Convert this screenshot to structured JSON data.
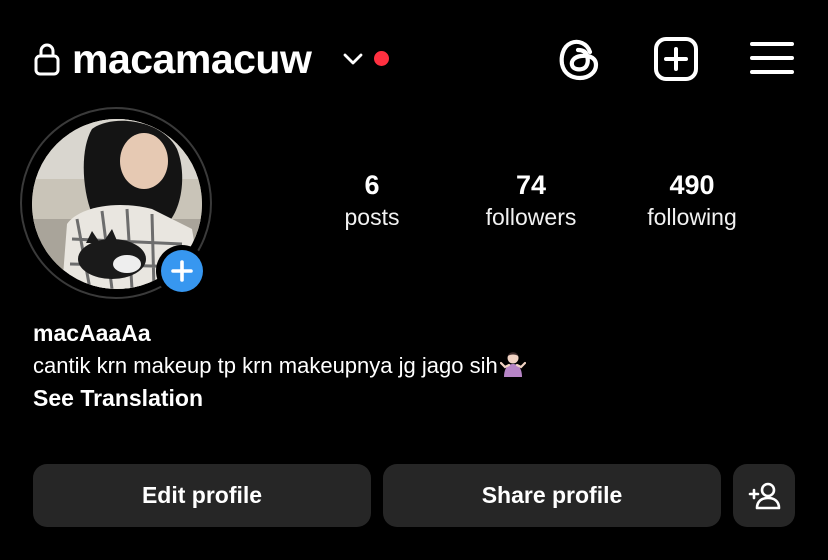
{
  "header": {
    "username": "macamacuw",
    "icons": {
      "lock": "lock-icon",
      "chevron": "chevron-down-icon",
      "threads": "threads-icon",
      "new_post": "plus-square-icon",
      "menu": "hamburger-menu-icon"
    },
    "notification_color": "#ff3040"
  },
  "profile": {
    "display_name": "macAaaAa",
    "bio": "cantik krn makeup tp krn makeupnya jg jago sih",
    "bio_emoji": "person-shrugging-emoji",
    "see_translation": "See Translation"
  },
  "stats": {
    "posts": {
      "value": "6",
      "label": "posts"
    },
    "followers": {
      "value": "74",
      "label": "followers"
    },
    "following": {
      "value": "490",
      "label": "following"
    }
  },
  "buttons": {
    "edit_profile": "Edit profile",
    "share_profile": "Share profile",
    "discover_icon": "add-person-icon"
  },
  "colors": {
    "background": "#000000",
    "button_bg": "#262626",
    "accent_blue": "#3797f0"
  }
}
